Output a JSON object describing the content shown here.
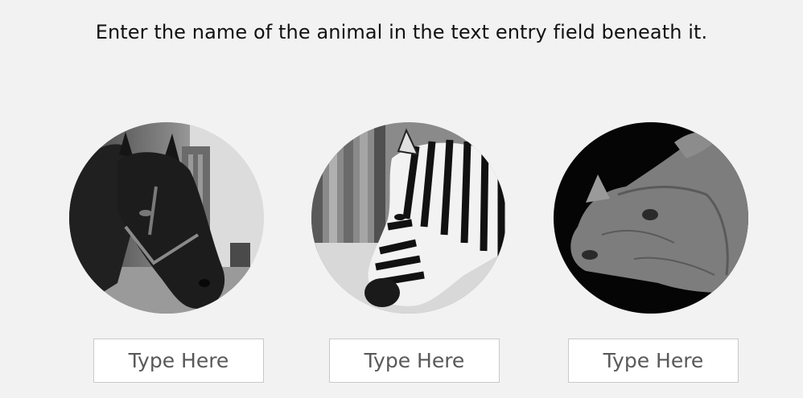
{
  "instruction": "Enter the name of the animal in the text entry field beneath it.",
  "animals": [
    {
      "image": "horse-photo",
      "input_value": "",
      "placeholder": "Type Here"
    },
    {
      "image": "zebra-photo",
      "input_value": "",
      "placeholder": "Type Here"
    },
    {
      "image": "rhino-photo",
      "input_value": "",
      "placeholder": "Type Here"
    }
  ]
}
